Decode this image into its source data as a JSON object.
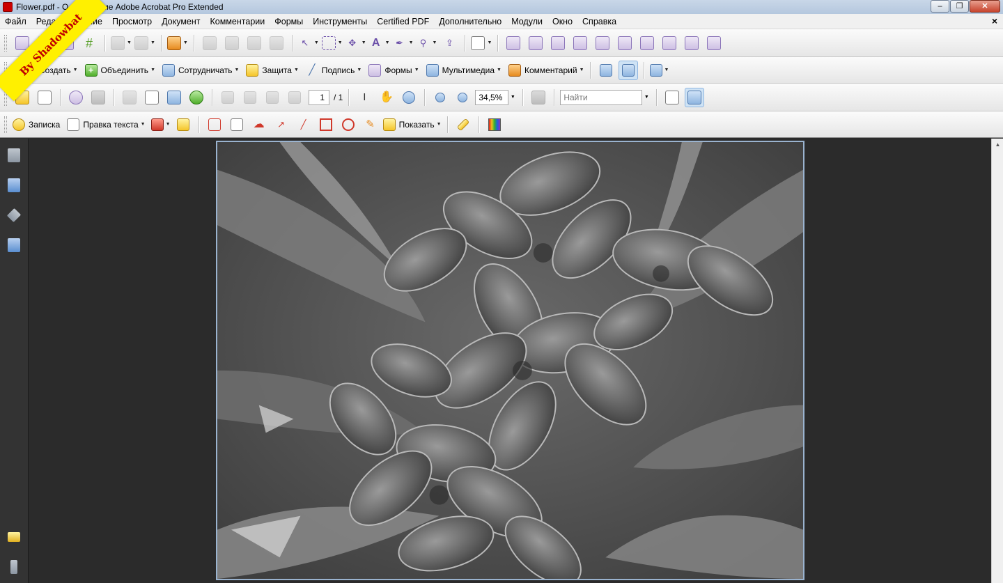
{
  "window": {
    "title": "Flower.pdf - О программе Adobe Acrobat Pro Extended",
    "controls": {
      "minimize": "–",
      "maximize": "❐",
      "close": "✕"
    }
  },
  "menubar": {
    "items": [
      "Файл",
      "Редактирование",
      "Просмотр",
      "Документ",
      "Комментарии",
      "Формы",
      "Инструменты",
      "Certified PDF",
      "Дополнительно",
      "Модули",
      "Окно",
      "Справка"
    ],
    "close": "×"
  },
  "tasks_toolbar": {
    "create": "Создать",
    "combine": "Объединить",
    "collaborate": "Сотрудничать",
    "secure": "Защита",
    "sign": "Подпись",
    "forms": "Формы",
    "multimedia": "Мультимедиа",
    "comment": "Комментарий"
  },
  "navigation_toolbar": {
    "current_page": "1",
    "total_pages": "/ 1",
    "zoom": "34,5%",
    "find_placeholder": "Найти"
  },
  "comment_toolbar": {
    "sticky_note": "Записка",
    "text_edits": "Правка текста",
    "show": "Показать"
  },
  "watermark": {
    "text": "By Shadowbat"
  },
  "colors": {
    "titlebar": "#b4c7de",
    "toolbar": "#eeeeee",
    "doc_background": "#2b2b2b",
    "page_border": "#9ab3cf",
    "watermark_bg": "#fff000",
    "watermark_text": "#c00000"
  },
  "icons": {
    "left_panel": [
      "pages-icon",
      "bookmarks-icon",
      "layers-icon",
      "signatures-icon",
      "comments-icon",
      "attachments-icon"
    ]
  }
}
